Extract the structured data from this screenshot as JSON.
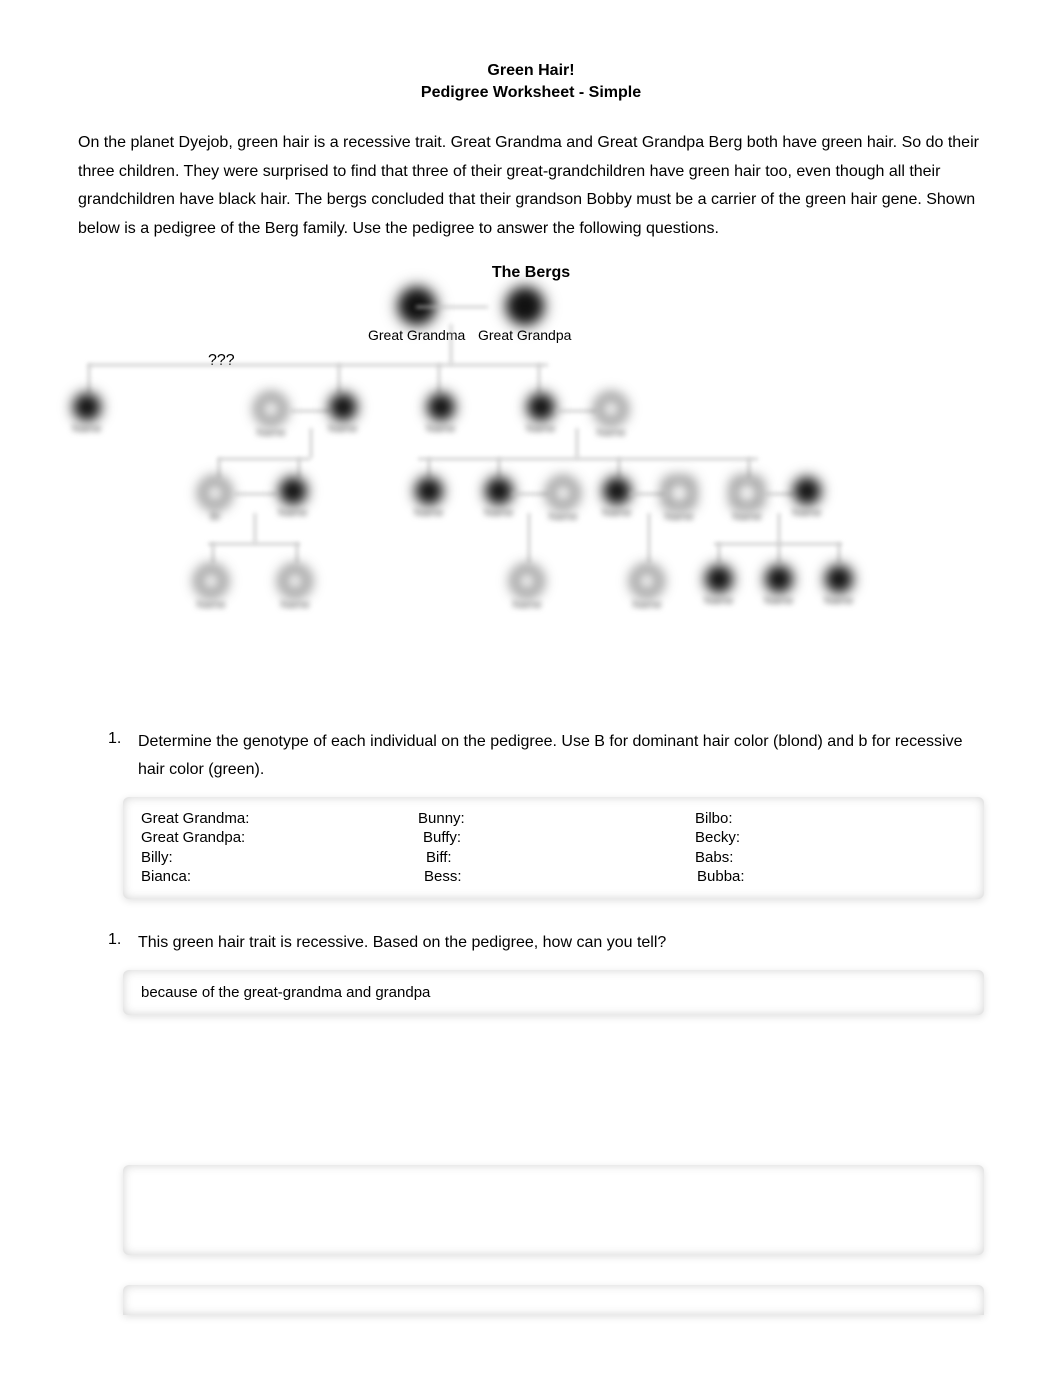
{
  "title": {
    "line1": "Green Hair!",
    "line2": "Pedigree Worksheet - Simple"
  },
  "intro": "On the planet Dyejob, green hair is a recessive trait.  Great Grandma and Great Grandpa Berg both have green hair.  So do their three children.  They were surprised to find that three of their great-grandchildren have green hair too, even though all their grandchildren have black hair.  The bergs concluded that their grandson Bobby must be a carrier of the green hair gene.  Shown below is a pedigree of the Berg family.  Use the pedigree to answer the following questions.",
  "pedigree_title": "The Bergs",
  "labels": {
    "ggma": "Great Grandma",
    "ggpa": "Great Grandpa",
    "qmarks": "???"
  },
  "questions": {
    "q1": {
      "num": "1.",
      "text": "Determine the genotype of each individual on the pedigree. Use B for dominant hair color (blond) and b for recessive hair color (green).",
      "col1": [
        "Great Grandma:",
        "Great Grandpa:",
        "Billy:",
        "Bianca:"
      ],
      "col2": [
        "Bunny:",
        "Buffy:",
        "Biff:",
        "Bess:"
      ],
      "col3": [
        "Bilbo:",
        "Becky:",
        "Babs:",
        "Bubba:"
      ]
    },
    "q2": {
      "num": "1.",
      "text": "This green hair trait is recessive.  Based on the pedigree, how can you tell?",
      "answer": "because of the great-grandma and grandpa"
    }
  },
  "pedigree_names": {
    "billy": "Billy",
    "bianca": "Bianca",
    "bunny": "Bunny",
    "buffy": "Buffy",
    "biff": "Biff",
    "bess": "Bess",
    "bilbo": "Bilbo",
    "becky": "Becky",
    "babs": "Babs",
    "bubba": "Bubba",
    "bobby": "Bobby"
  }
}
